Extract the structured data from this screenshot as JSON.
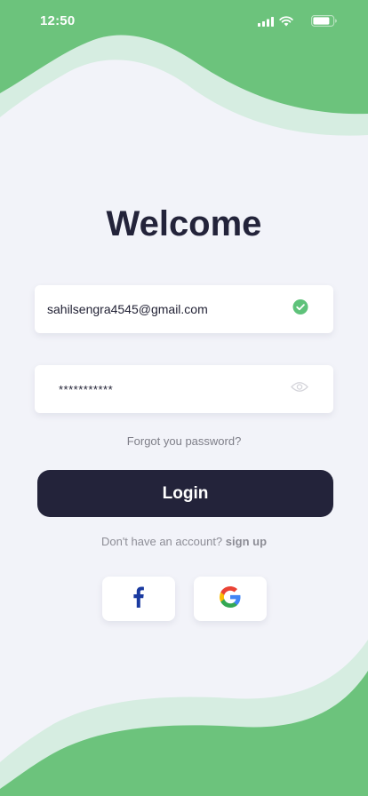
{
  "status_bar": {
    "time": "12:50",
    "icons": [
      "signal-icon",
      "wifi-icon",
      "battery-icon"
    ]
  },
  "page": {
    "title": "Welcome"
  },
  "email_field": {
    "value": "sahilsengra4545@gmail.com",
    "status_icon": "check-circle-icon"
  },
  "password_field": {
    "value": "***********",
    "toggle_icon": "eye-icon"
  },
  "forgot_password_link": "Forgot you password?",
  "login_button": "Login",
  "signup": {
    "prompt": "Don't have an account?",
    "link": "sign up"
  },
  "social_login": [
    {
      "provider": "facebook",
      "icon": "facebook-icon"
    },
    {
      "provider": "google",
      "icon": "google-icon"
    }
  ],
  "colors": {
    "accent_green": "#6cc37c",
    "light_green": "#d6ede1",
    "dark_button": "#23233a",
    "background": "#f2f3f9",
    "facebook_blue": "#1a3aa0"
  }
}
